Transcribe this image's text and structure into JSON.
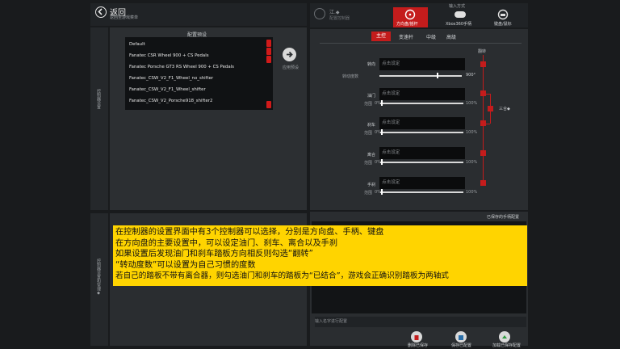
{
  "header": {
    "back_label": "返回",
    "back_sub": "返回至游戏菜单",
    "top_title": "江.◆",
    "top_sub": "配置控制器"
  },
  "input_mode": {
    "title": "输入方式",
    "options": [
      {
        "label": "方向盘/摇杆",
        "active": true
      },
      {
        "label": "Xbox360手柄",
        "active": false
      },
      {
        "label": "键盘/鼠标",
        "active": false
      }
    ]
  },
  "sub_tabs": [
    "主控",
    "变速杆",
    "中级",
    "高级"
  ],
  "presets": {
    "title": "配置预设",
    "items": [
      "Default",
      "Fanatec CSR Wheel 900 + CS Pedals",
      "Fanatec Porsche GT3 RS Wheel 900 + CS Pedals",
      "Fanatec_CSW_V2_F1_Wheel_no_shifter",
      "Fanatec_CSW_V2_F1_Wheel_shifter",
      "Fanatec_CSW_V2_Porsche918_shifter2"
    ],
    "apply_label": "应用预设"
  },
  "left_labels": {
    "upper": "控制器设置",
    "lower": "控制器设置和管理◆"
  },
  "controls": {
    "invert_header": "翻转",
    "steering": {
      "label": "转向",
      "placeholder": "点击设定",
      "rotation_label": "转动度数",
      "rotation_value": "900°",
      "rotation_fraction": 0.7
    },
    "throttle": {
      "label": "油门",
      "placeholder": "点击设定",
      "range_label": "范围",
      "min": "0%",
      "max": "100%"
    },
    "brake": {
      "label": "刹车",
      "placeholder": "点击设定",
      "range_label": "范围",
      "min": "0%",
      "max": "100%"
    },
    "clutch": {
      "label": "离合",
      "placeholder": "点击设定",
      "range_label": "范围",
      "min": "0%",
      "max": "100%"
    },
    "handbrake": {
      "label": "手刹",
      "placeholder": "点击设定",
      "range_label": "范围",
      "min": "0%",
      "max": "100%"
    },
    "combined_label": "三合◆"
  },
  "saved": {
    "title": "已保存的手柄配置",
    "name_placeholder": "输入名字进行配置",
    "buttons": [
      "删除已保存",
      "保存已配置",
      "加载已保存配置"
    ]
  },
  "overlay": {
    "lines": [
      "在控制器的设置界面中有3个控制器可以选择，分别是方向盘、手柄、键盘",
      "在方向盘的主要设置中，可以设定油门、刹车、离合以及手刹",
      "如果设置后发现油门和刹车踏板方向相反则勾选“翻转”",
      "“转动度数”可以设置为自己习惯的度数",
      "若自己的踏板不带有离合器，则勾选油门和刹车的踏板为“已结合”，游戏会正确识别踏板为两轴式"
    ]
  },
  "colors": {
    "accent": "#c41c1c",
    "overlay_bg": "#ffd400",
    "panel": "#2a2d30"
  }
}
